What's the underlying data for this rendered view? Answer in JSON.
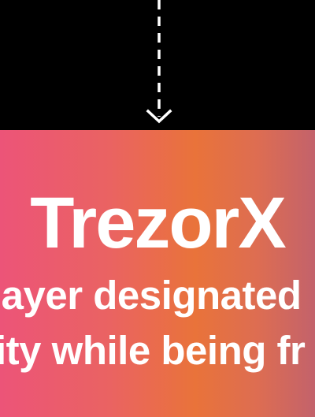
{
  "hero": {
    "title": "TrezorX",
    "tagline_line1": "layer designated",
    "tagline_line2": "ity while being fr"
  },
  "colors": {
    "background": "#000000",
    "gradient_start": "#ec5478",
    "gradient_mid": "#e9733a",
    "gradient_end": "#c3626b",
    "text": "#ffffff"
  },
  "icons": {
    "scroll_arrow": "dashed-down-arrow-icon"
  }
}
